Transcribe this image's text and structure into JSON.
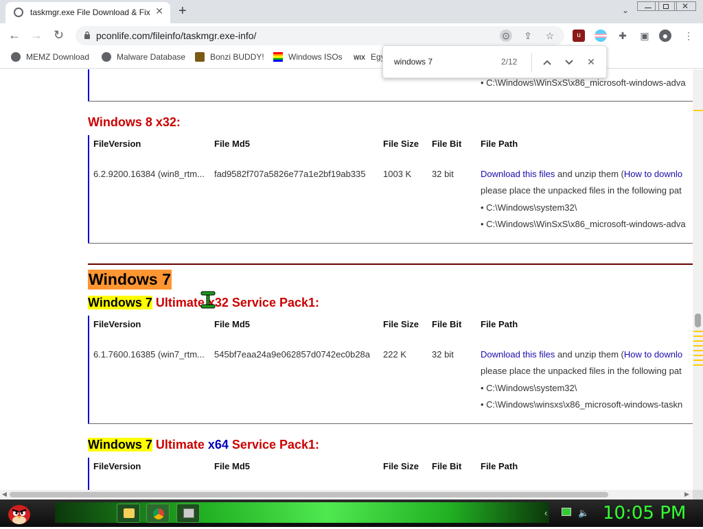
{
  "browser": {
    "tab_title": "taskmgr.exe File Download & Fix",
    "tab_close": "✕",
    "new_tab": "+",
    "url": "pconlife.com/fileinfo/taskmgr.exe-info/",
    "extension_badge": "6"
  },
  "bookmarks": [
    {
      "label": "MEMZ Download"
    },
    {
      "label": "Malware Database"
    },
    {
      "label": "Bonzi BUDDY!"
    },
    {
      "label": "Windows ISOs"
    },
    {
      "label": "Egy"
    }
  ],
  "find": {
    "query": "windows 7",
    "count": "2/12",
    "prev": "⌃",
    "next": "⌄",
    "close": "✕"
  },
  "page": {
    "top_path": "• C:\\Windows\\WinSxS\\x86_microsoft-windows-adva",
    "headers": {
      "file_version": "FileVersion",
      "file_md5": "File Md5",
      "file_size": "File Size",
      "file_bit": "File Bit",
      "file_path": "File Path"
    },
    "win8": {
      "heading": "Windows 8 x32:",
      "version": "6.2.9200.16384 (win8_rtm...",
      "md5": "fad9582f707a5826e77a1e2bf19ab335",
      "size": "1003 K",
      "bit": "32 bit",
      "link": "Download this files",
      "link_after": " and unzip them (",
      "howto": "How to downlo",
      "place": "please place the unpacked files in the following pat",
      "path1": "• C:\\Windows\\system32\\",
      "path2": "• C:\\Windows\\WinSxS\\x86_microsoft-windows-adva"
    },
    "win7_title": "Windows 7",
    "win7_x32": {
      "hl": "Windows 7",
      "rest": " Ultimate x32 Service Pack1:",
      "version": "6.1.7600.16385 (win7_rtm...",
      "md5": "545bf7eaa24a9e062857d0742ec0b28a",
      "size": "222 K",
      "bit": "32 bit",
      "link": "Download this files",
      "link_after": " and unzip them (",
      "howto": "How to downlo",
      "place": "please place the unpacked files in the following pat",
      "path1": "• C:\\Windows\\system32\\",
      "path2": "• C:\\Windows\\winsxs\\x86_microsoft-windows-taskn"
    },
    "win7_x64": {
      "hl": "Windows 7",
      "ultimate": " Ultimate ",
      "arch": "x64",
      "rest": " Service Pack1:"
    }
  },
  "taskbar": {
    "clock": "10:05 PM"
  }
}
